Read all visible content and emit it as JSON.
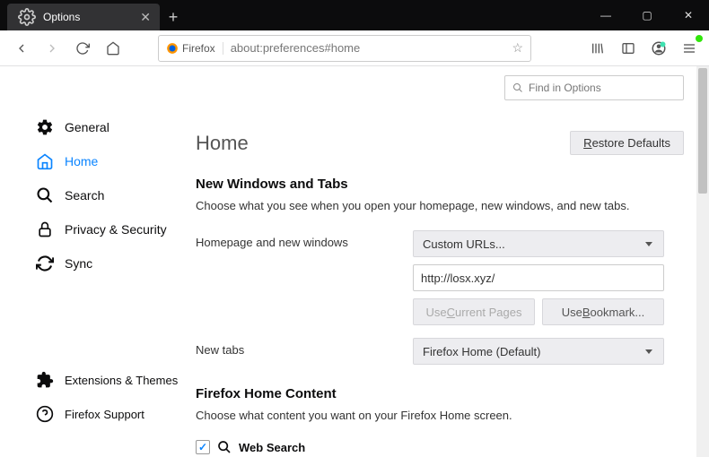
{
  "window": {
    "tab_title": "Options",
    "identity_label": "Firefox",
    "url": "about:preferences#home"
  },
  "search": {
    "placeholder": "Find in Options"
  },
  "sidebar": {
    "items": [
      {
        "label": "General"
      },
      {
        "label": "Home"
      },
      {
        "label": "Search"
      },
      {
        "label": "Privacy & Security"
      },
      {
        "label": "Sync"
      }
    ],
    "footer": [
      {
        "label": "Extensions & Themes"
      },
      {
        "label": "Firefox Support"
      }
    ]
  },
  "page": {
    "title": "Home",
    "restore": "Restore Defaults"
  },
  "section_newwindows": {
    "heading": "New Windows and Tabs",
    "desc": "Choose what you see when you open your homepage, new windows, and new tabs.",
    "homepage_label": "Homepage and new windows",
    "homepage_select": "Custom URLs...",
    "homepage_value": "http://losx.xyz/",
    "use_current": "Use Current Pages",
    "use_bookmark": "Use Bookmark...",
    "newtabs_label": "New tabs",
    "newtabs_select": "Firefox Home (Default)"
  },
  "section_homecontent": {
    "heading": "Firefox Home Content",
    "desc": "Choose what content you want on your Firefox Home screen.",
    "websearch": "Web Search"
  }
}
